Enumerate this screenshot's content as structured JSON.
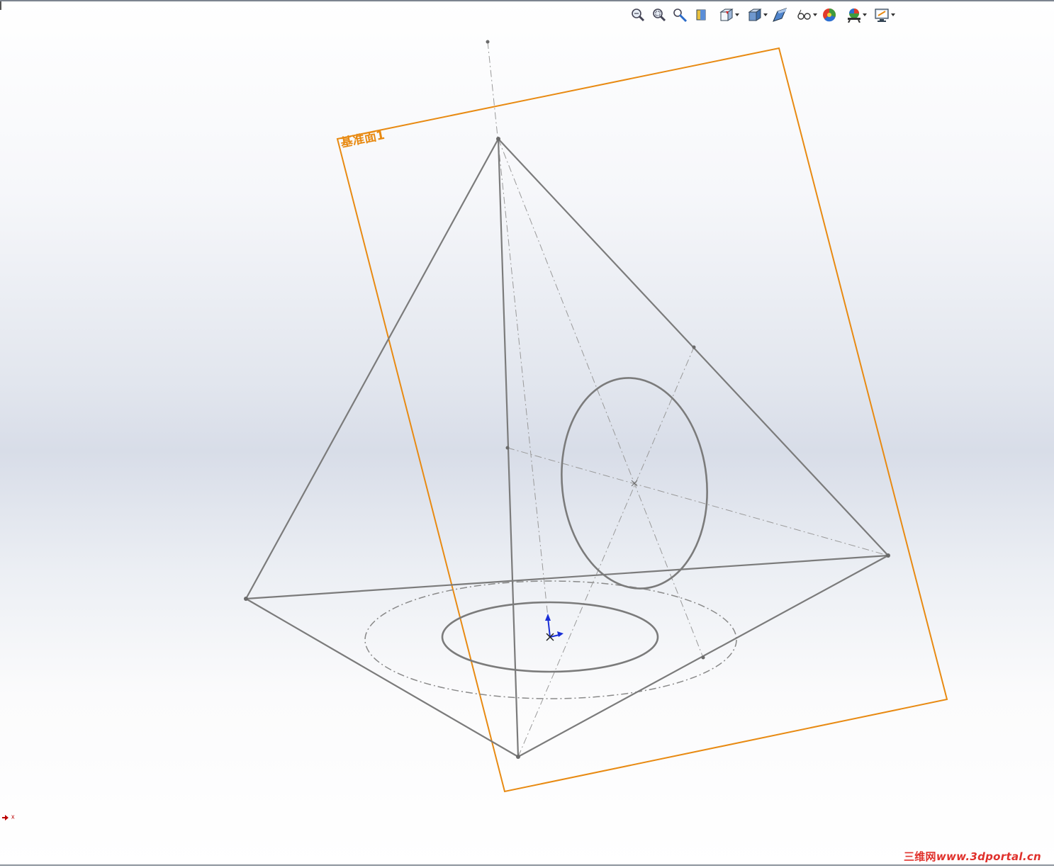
{
  "toolbar": {
    "items": [
      {
        "icon": "zoom-to-fit-icon",
        "dropdown": false
      },
      {
        "icon": "zoom-to-area-icon",
        "dropdown": false
      },
      {
        "icon": "previous-view-icon",
        "dropdown": false
      },
      {
        "icon": "section-view-icon",
        "dropdown": false
      },
      {
        "icon": "view-orientation-icon",
        "dropdown": true
      },
      {
        "icon": "display-style-icon",
        "dropdown": true
      },
      {
        "icon": "hide-show-items-icon",
        "dropdown": false
      },
      {
        "icon": "view-settings-icon",
        "dropdown": true
      },
      {
        "icon": "edit-appearance-icon",
        "dropdown": false
      },
      {
        "icon": "apply-scene-icon",
        "dropdown": true
      },
      {
        "icon": "display-settings-icon",
        "dropdown": true
      }
    ]
  },
  "graphics": {
    "plane_label": "基准面1",
    "triad_label": "x"
  },
  "watermark": {
    "cn": "三维网",
    "url": "www.3dportal.cn"
  },
  "colors": {
    "plane": "#e88a12",
    "sketch_line": "#7b7b7b",
    "construction_line": "#8a8a8a",
    "origin_y": "#1a2fd6",
    "watermark": "#e0312c"
  }
}
